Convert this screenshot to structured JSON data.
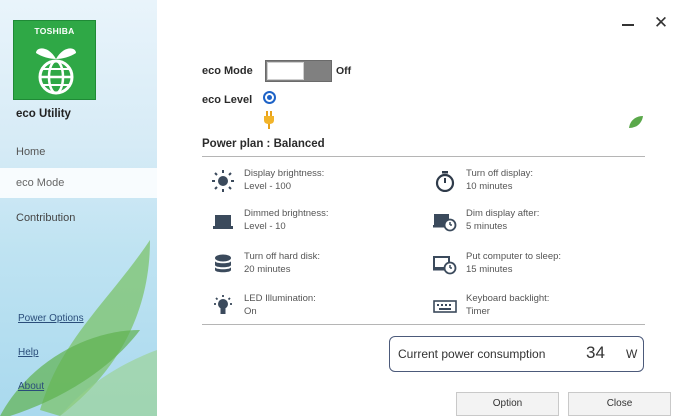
{
  "sidebar": {
    "brand": "TOSHIBA",
    "app_name": "eco Utility",
    "nav": {
      "home": "Home",
      "eco_mode": "eco Mode",
      "contribution": "Contribution"
    },
    "links": {
      "power_options": "Power Options",
      "help": "Help",
      "about": "About"
    }
  },
  "window": {
    "minimize_icon": "minimize-icon",
    "close_glyph": "✕"
  },
  "eco": {
    "mode_label": "eco Mode",
    "mode_state": "Off",
    "level_label": "eco Level"
  },
  "power_plan": {
    "title": "Power plan : Balanced",
    "settings": [
      {
        "icon": "brightness-icon",
        "label": "Display brightness:",
        "value": "Level - 100"
      },
      {
        "icon": "timer-icon",
        "label": "Turn off display:",
        "value": "10 minutes"
      },
      {
        "icon": "laptop-icon",
        "label": "Dimmed brightness:",
        "value": "Level - 10"
      },
      {
        "icon": "dim-display-clock-icon",
        "label": "Dim display after:",
        "value": "5 minutes"
      },
      {
        "icon": "hard-disk-icon",
        "label": "Turn off hard disk:",
        "value": "20 minutes"
      },
      {
        "icon": "sleep-clock-icon",
        "label": "Put computer to sleep:",
        "value": "15 minutes"
      },
      {
        "icon": "led-icon",
        "label": "LED Illumination:",
        "value": "On"
      },
      {
        "icon": "keyboard-icon",
        "label": "Keyboard backlight:",
        "value": "Timer"
      }
    ]
  },
  "consumption": {
    "label": "Current power consumption",
    "value": "34",
    "unit": "W"
  },
  "buttons": {
    "option": "Option",
    "close": "Close"
  },
  "colors": {
    "brand_green": "#2fa846",
    "accent_blue": "#1e63c7",
    "toggle_gray": "#808080"
  }
}
